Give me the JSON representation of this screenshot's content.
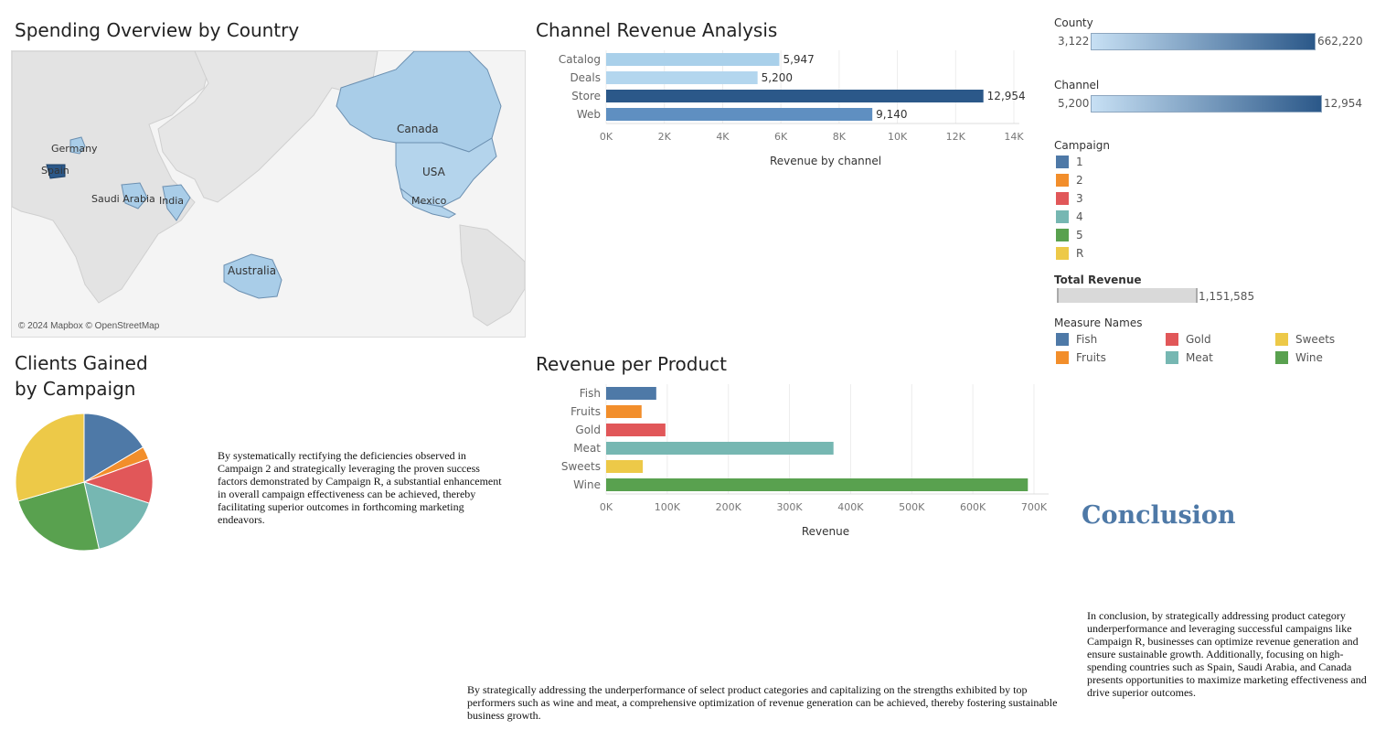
{
  "map": {
    "title": "Spending Overview by Country",
    "attribution": "© 2024 Mapbox © OpenStreetMap",
    "countries": [
      "Germany",
      "Spain",
      "Saudi Arabia",
      "India",
      "Canada",
      "USA",
      "Mexico",
      "Australia"
    ]
  },
  "pie": {
    "title_line1": "Clients Gained",
    "title_line2": "by Campaign",
    "note": "By systematically rectifying the deficiencies observed in Campaign 2 and strategically leveraging the proven success factors demonstrated by Campaign R, a substantial enhancement in overall campaign effectiveness can be achieved, thereby facilitating superior outcomes in forthcoming marketing endeavors."
  },
  "channel": {
    "title": "Channel Revenue Analysis",
    "xlabel": "Revenue by channel"
  },
  "product": {
    "title": "Revenue per Product",
    "xlabel": "Revenue"
  },
  "legends": {
    "county_title": "County",
    "county_min": "3,122",
    "county_max": "662,220",
    "channel_title": "Channel",
    "channel_min": "5,200",
    "channel_max": "12,954",
    "campaign_title": "Campaign",
    "campaign_items": [
      {
        "label": "1",
        "color": "#4e79a7"
      },
      {
        "label": "2",
        "color": "#f28e2b"
      },
      {
        "label": "3",
        "color": "#e15759"
      },
      {
        "label": "4",
        "color": "#76b7b2"
      },
      {
        "label": "5",
        "color": "#59a14f"
      },
      {
        "label": "R",
        "color": "#edc948"
      }
    ],
    "total_title": "Total Revenue",
    "total_value": "1,151,585",
    "measure_title": "Measure Names",
    "measure_items": [
      {
        "label": "Fish",
        "color": "#4e79a7"
      },
      {
        "label": "Gold",
        "color": "#e15759"
      },
      {
        "label": "Sweets",
        "color": "#edc948"
      },
      {
        "label": "Fruits",
        "color": "#f28e2b"
      },
      {
        "label": "Meat",
        "color": "#76b7b2"
      },
      {
        "label": "Wine",
        "color": "#59a14f"
      }
    ]
  },
  "conclusion": {
    "heading": "Conclusion",
    "text": "In conclusion, by strategically addressing product category underperformance and leveraging successful campaigns like Campaign R, businesses can optimize revenue generation and ensure sustainable growth. Additionally, focusing on high-spending countries such as Spain, Saudi Arabia, and Canada presents opportunities to maximize marketing effectiveness and drive superior outcomes."
  },
  "bottom_note": "By strategically addressing the underperformance of select product categories and capitalizing on the strengths exhibited by top performers such as wine and meat, a comprehensive optimization of revenue generation can be achieved, thereby fostering sustainable business growth.",
  "chart_data": [
    {
      "type": "bar",
      "orientation": "horizontal",
      "title": "Channel Revenue Analysis",
      "xlabel": "Revenue by channel",
      "categories": [
        "Catalog",
        "Deals",
        "Store",
        "Web"
      ],
      "values": [
        5947,
        5200,
        12954,
        9140
      ],
      "value_labels": [
        "5,947",
        "5,200",
        "12,954",
        "9,140"
      ],
      "colors": [
        "#a9d0ea",
        "#b3d6ee",
        "#2b5889",
        "#5f8fc1"
      ],
      "xlim": [
        0,
        14000
      ],
      "ticks": [
        0,
        2000,
        4000,
        6000,
        8000,
        10000,
        12000,
        14000
      ],
      "tick_labels": [
        "0K",
        "2K",
        "4K",
        "6K",
        "8K",
        "10K",
        "12K",
        "14K"
      ],
      "grid": true
    },
    {
      "type": "bar",
      "orientation": "horizontal",
      "title": "Revenue per Product",
      "xlabel": "Revenue",
      "categories": [
        "Fish",
        "Fruits",
        "Gold",
        "Meat",
        "Sweets",
        "Wine"
      ],
      "values": [
        82000,
        58000,
        97000,
        372000,
        60000,
        690000
      ],
      "colors": [
        "#4e79a7",
        "#f28e2b",
        "#e15759",
        "#76b7b2",
        "#edc948",
        "#59a14f"
      ],
      "xlim": [
        0,
        715000
      ],
      "ticks": [
        0,
        100000,
        200000,
        300000,
        400000,
        500000,
        600000,
        700000
      ],
      "tick_labels": [
        "0K",
        "100K",
        "200K",
        "300K",
        "400K",
        "500K",
        "600K",
        "700K"
      ],
      "grid": true
    },
    {
      "type": "pie",
      "title": "Clients Gained by Campaign",
      "categories": [
        "1",
        "2",
        "3",
        "4",
        "5",
        "R"
      ],
      "values": [
        16.5,
        3.0,
        10.5,
        16.5,
        24.0,
        29.5
      ],
      "colors": [
        "#4e79a7",
        "#f28e2b",
        "#e15759",
        "#76b7b2",
        "#59a14f",
        "#edc948"
      ]
    }
  ]
}
